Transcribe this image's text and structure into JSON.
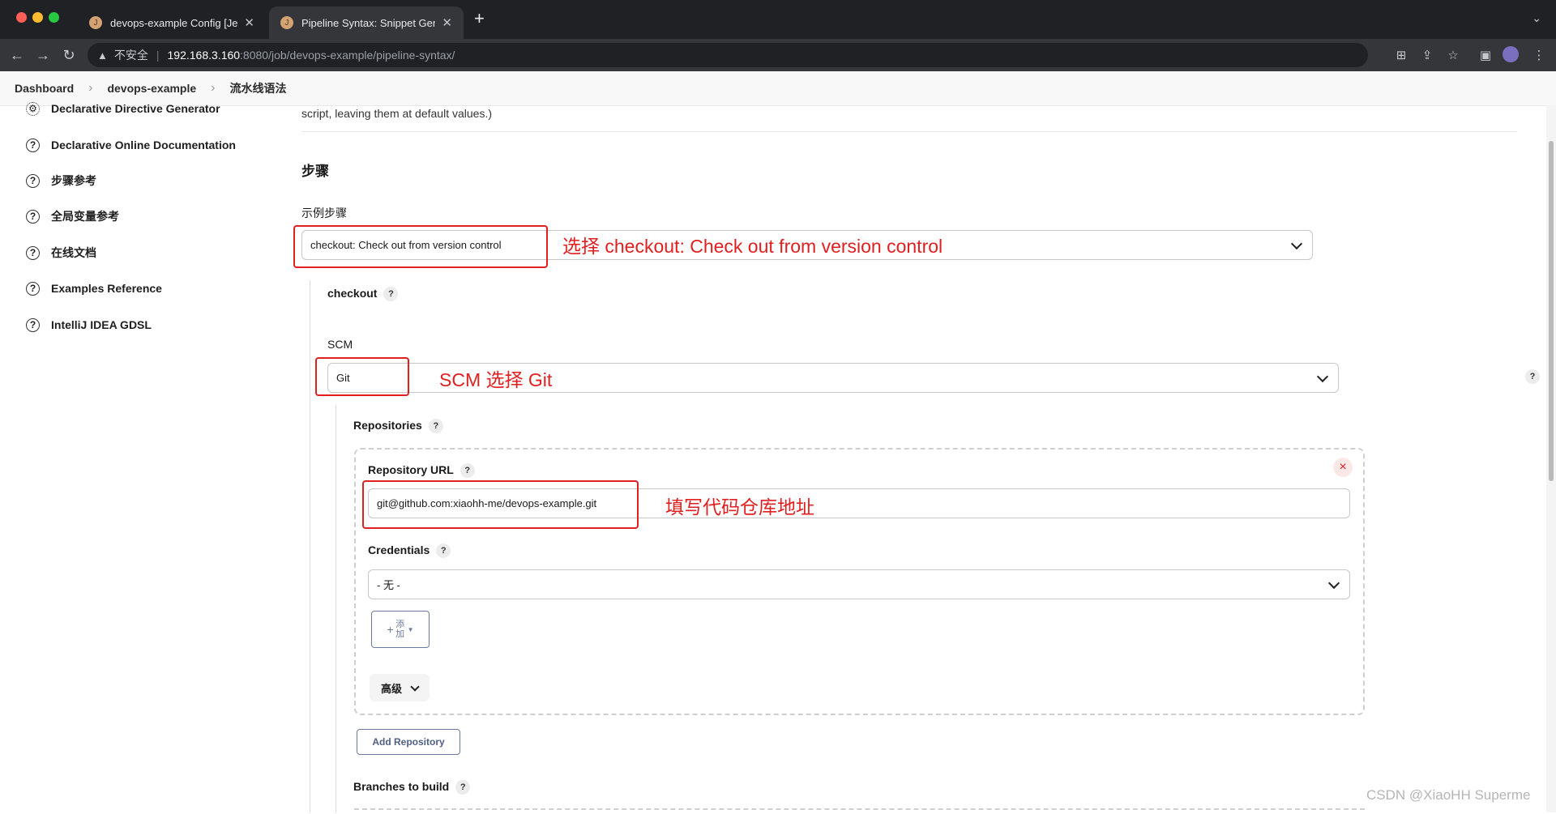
{
  "browser": {
    "tabs": [
      {
        "title": "devops-example Config [Jenkins]",
        "active": false
      },
      {
        "title": "Pipeline Syntax: Snippet Generator",
        "active": true
      }
    ],
    "new_tab": "+",
    "security_label": "不安全",
    "url_host": "192.168.3.160",
    "url_rest": ":8080/job/devops-example/pipeline-syntax/"
  },
  "breadcrumb": {
    "items": [
      "Dashboard",
      "devops-example",
      "流水线语法"
    ]
  },
  "sidebar": {
    "items": [
      {
        "label": "Declarative Directive Generator",
        "icon": "gear-icon"
      },
      {
        "label": "Declarative Online Documentation",
        "icon": "help-icon"
      },
      {
        "label": "步骤参考",
        "icon": "help-icon"
      },
      {
        "label": "全局变量参考",
        "icon": "help-icon"
      },
      {
        "label": "在线文档",
        "icon": "help-icon"
      },
      {
        "label": "Examples Reference",
        "icon": "help-icon"
      },
      {
        "label": "IntelliJ IDEA GDSL",
        "icon": "help-icon"
      }
    ]
  },
  "main": {
    "intro_tail": "script, leaving them at default values.)",
    "section_title": "步骤",
    "sample_step_label": "示例步骤",
    "sample_step_value": "checkout: Check out from version control",
    "checkout_label": "checkout",
    "scm_label": "SCM",
    "scm_value": "Git",
    "repositories_label": "Repositories",
    "repo_url_label": "Repository URL",
    "repo_url_value": "git@github.com:xiaohh-me/devops-example.git",
    "credentials_label": "Credentials",
    "credentials_value": "- 无 -",
    "add_button_icon": "+",
    "add_button_label": "添加",
    "advanced_label": "高级",
    "add_repository_label": "Add Repository",
    "branches_label": "Branches to build",
    "help_mark": "?",
    "delete_mark": "×"
  },
  "annotations": {
    "step_note": "选择 checkout: Check out from version control",
    "scm_note": "SCM 选择 Git",
    "url_note": "填写代码仓库地址",
    "color": "#e02020"
  },
  "watermark": "CSDN @XiaoHH Superme"
}
